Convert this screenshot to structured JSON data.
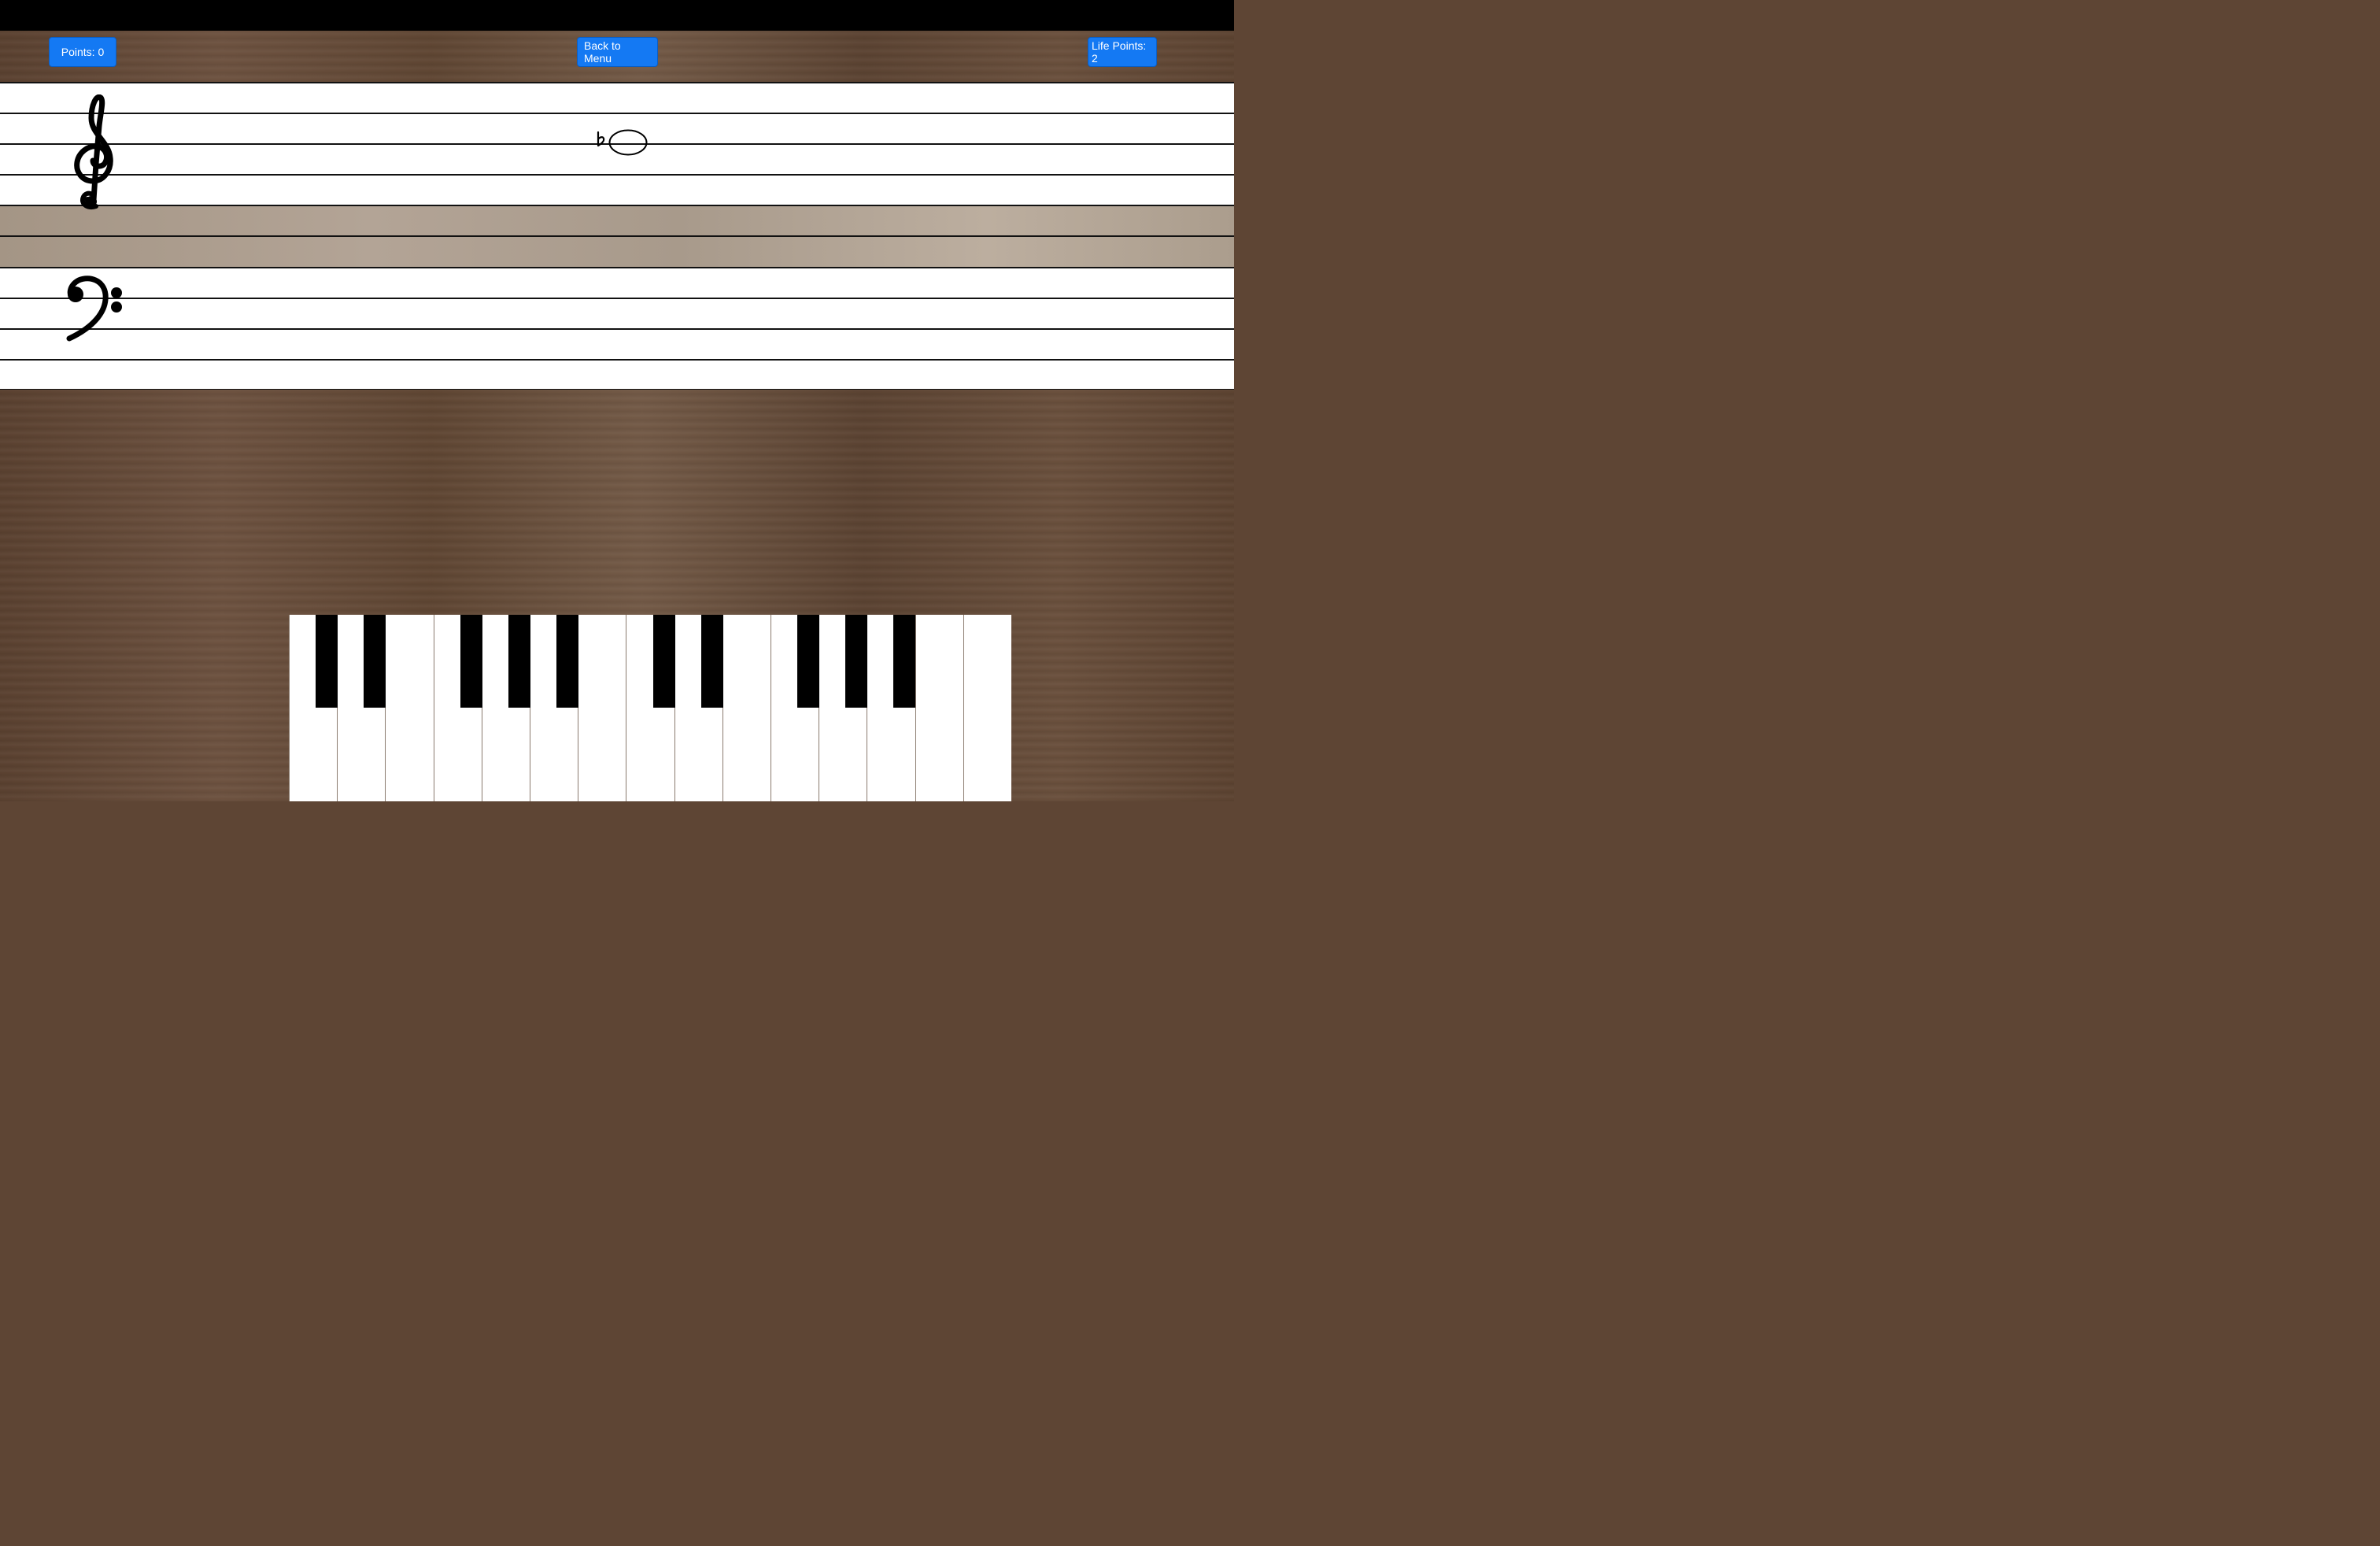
{
  "hud": {
    "points_label": "Points: 0",
    "menu_label": "Back to Menu",
    "life_label": "Life Points: 2"
  },
  "colors": {
    "button": "#1479f3",
    "staff": "#ffffff",
    "black_key": "#000000"
  },
  "icons": {
    "treble": "treble-clef-icon",
    "bass": "bass-clef-icon",
    "flat": "flat-accidental-icon",
    "note": "whole-note-icon"
  },
  "current_note": {
    "accidental": "flat",
    "shape": "whole note"
  },
  "piano": {
    "white_keys": 15,
    "black_keys": 10
  }
}
